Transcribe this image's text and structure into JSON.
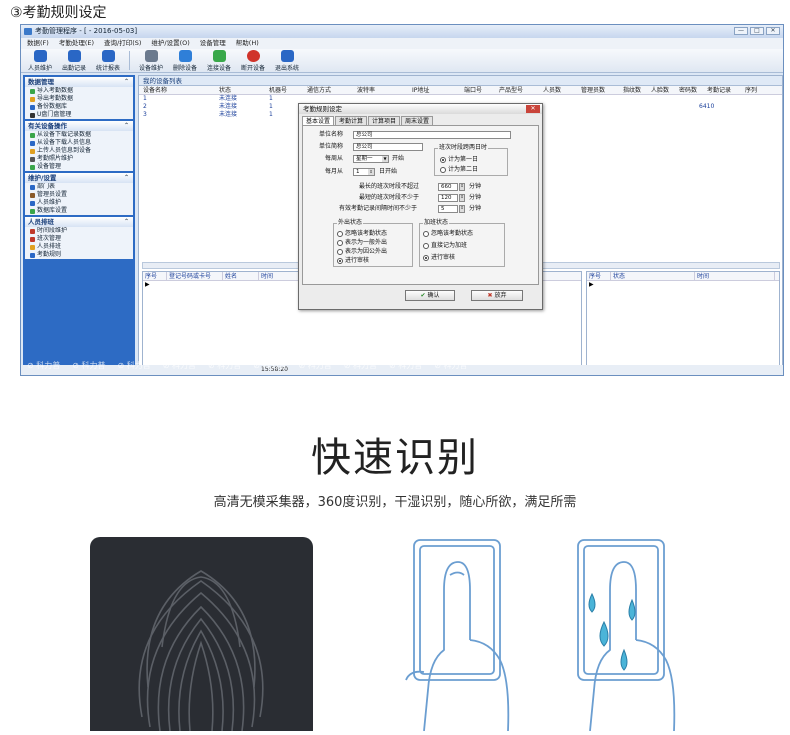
{
  "step_label": "③考勤规则设定",
  "window": {
    "title": "考勤管理程序 - [ - 2016-05-03]",
    "buttons": [
      "—",
      "□",
      "✕"
    ]
  },
  "menu": [
    "数据(F)",
    "考勤处理(E)",
    "查询/打印(S)",
    "维护/设置(O)",
    "设备管理",
    "帮助(H)"
  ],
  "toolbar": [
    {
      "label": "人员维护",
      "icon": "users-icon",
      "color": "blue"
    },
    {
      "label": "出勤记录",
      "icon": "record-icon",
      "color": "blue"
    },
    {
      "label": "统计报表",
      "icon": "report-icon",
      "color": "blue"
    },
    {
      "label": "设备维护",
      "icon": "device-icon",
      "color": "gray"
    },
    {
      "label": "删除设备",
      "icon": "delete-icon",
      "color": "x"
    },
    {
      "label": "连接设备",
      "icon": "connect-icon",
      "color": "green"
    },
    {
      "label": "断开设备",
      "icon": "disconnect-icon",
      "color": "red"
    },
    {
      "label": "退出系统",
      "icon": "exit-icon",
      "color": "blue"
    }
  ],
  "sidebar": [
    {
      "title": "数据管理",
      "items": [
        "导入考勤数据",
        "导出考勤数据",
        "备份数据库",
        "U盘门盘管理"
      ]
    },
    {
      "title": "有关设备操作",
      "items": [
        "从设备下载记录数据",
        "从设备下载人员信息",
        "上传人员信息到设备",
        "考勤照片维护",
        "设备管理"
      ]
    },
    {
      "title": "维护/设置",
      "items": [
        "部门表",
        "管理员设置",
        "人员维护",
        "数据库设置"
      ]
    },
    {
      "title": "人员排班",
      "items": [
        "时间段维护",
        "班次管理",
        "人员排班",
        "考勤规则"
      ]
    }
  ],
  "device_panel": {
    "title": "我的设备列表",
    "columns": [
      "设备名称",
      "状态",
      "机器号",
      "通信方式",
      "波特率",
      "IP地址",
      "端口号",
      "产品型号",
      "人员数",
      "管理员数",
      "指纹数",
      "人脸数",
      "密码数",
      "考勤记录",
      "序列"
    ],
    "rows": [
      {
        "name": "1",
        "status": "未连接",
        "machine": "1",
        "serial": ""
      },
      {
        "name": "2",
        "status": "未连接",
        "machine": "1",
        "serial": "6410"
      },
      {
        "name": "3",
        "status": "未连接",
        "machine": "1",
        "serial": ""
      }
    ]
  },
  "log_left_columns": [
    "序号",
    "登记号码或卡号",
    "姓名",
    "时间"
  ],
  "log_right_columns": [
    "序号",
    "状态",
    "时间"
  ],
  "status_time": "15:58:20",
  "watermark": "科力普",
  "dialog": {
    "title": "考勤规则设定",
    "close": "✕",
    "tabs": [
      "基本设置",
      "考勤计算",
      "计算项目",
      "周末设置"
    ],
    "unit_name_label": "单位名称",
    "unit_name_value": "总公司",
    "unit_short_label": "单位简称",
    "unit_short_value": "总公司",
    "week_start_label": "每周从",
    "week_start_value": "星期一",
    "week_start_suffix": "开始",
    "month_start_label": "每月从",
    "month_start_value": "1",
    "month_start_suffix": "日开始",
    "cross_day_group": "班次时段跨两日时",
    "cross_day_options": [
      "计为第一日",
      "计为第二日"
    ],
    "max_shift_label": "最长的班次时段不超过",
    "max_shift_value": "660",
    "min_shift_label": "最短的班次时段不少于",
    "min_shift_value": "120",
    "valid_interval_label": "有效考勤记录间隔时间不少于",
    "valid_interval_value": "5",
    "minute_unit": "分钟",
    "out_group": "外出状态",
    "out_options": [
      "忽略该考勤状态",
      "表示为一般外出",
      "表示为因公外出",
      "进行审核"
    ],
    "overtime_group": "加班状态",
    "overtime_options": [
      "忽略该考勤状态",
      "直接记为加班",
      "进行审核"
    ],
    "ok_label": "确认",
    "cancel_label": "放弃"
  },
  "headline": "快速识别",
  "subline": "高清无模采集器，360度识别，干湿识别，随心所欲，满足所需"
}
